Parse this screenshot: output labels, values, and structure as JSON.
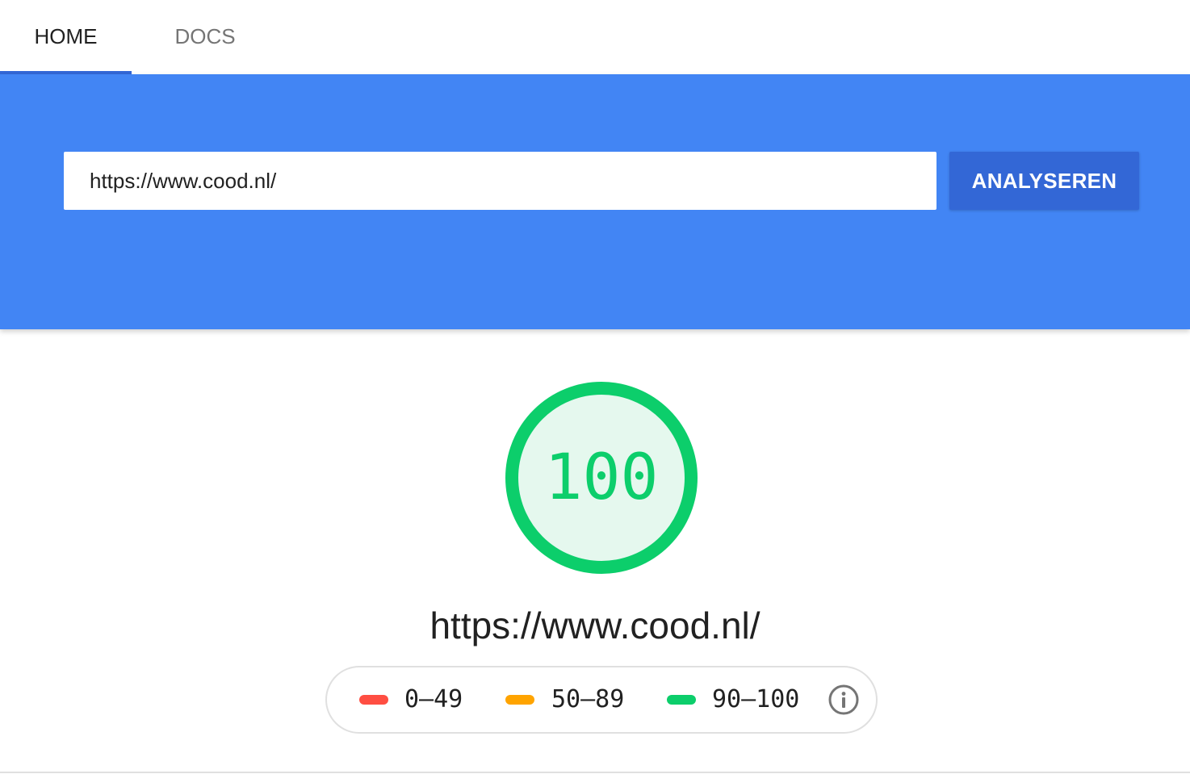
{
  "tabs": [
    {
      "label": "HOME",
      "active": true
    },
    {
      "label": "DOCS",
      "active": false
    }
  ],
  "search": {
    "value": "https://www.cood.nl/",
    "button_label": "ANALYSEREN"
  },
  "report": {
    "score": "100",
    "url": "https://www.cood.nl/"
  },
  "legend": [
    {
      "range": "0–49",
      "color": "#ff4e42"
    },
    {
      "range": "50–89",
      "color": "#ffa400"
    },
    {
      "range": "90–100",
      "color": "#0cce6b"
    }
  ],
  "icons": {
    "info": "info-icon"
  },
  "colors": {
    "primary": "#4285f4",
    "button": "#3367d6",
    "pass": "#0cce6b",
    "pass_fill": "#e5f8ee"
  }
}
